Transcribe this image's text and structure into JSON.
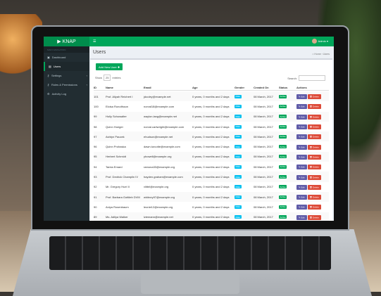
{
  "brand": "KNAP",
  "topbar": {
    "menu_icon": "☰",
    "user": "Admin ▾"
  },
  "sidebar": {
    "heading": "MAIN NAVIGATION",
    "items": [
      {
        "label": "Dashboard",
        "icon": "dashboard-icon",
        "glyph": "▣"
      },
      {
        "label": "Users",
        "icon": "users-icon",
        "glyph": "▤",
        "active": true
      },
      {
        "label": "Settings",
        "icon": "key-icon",
        "glyph": "⚷",
        "chevron": "‹"
      },
      {
        "label": "Roles & Permissions",
        "icon": "key-icon",
        "glyph": "⚷",
        "chevron": "‹"
      },
      {
        "label": "Activity Log",
        "icon": "gear-icon",
        "glyph": "⚙"
      }
    ]
  },
  "page": {
    "title": "Users",
    "breadcrumb": "⌂ Home › Users"
  },
  "toolbar": {
    "add_label": "Add New User ✚",
    "show": "Show",
    "entries_value": "25",
    "entries": "entries",
    "search_label": "Search:",
    "search_value": ""
  },
  "table": {
    "columns": [
      "ID",
      "Name",
      "Email",
      "Age",
      "Gender",
      "Created On",
      "Status",
      "Actions"
    ],
    "edit_label": "✎ Edit",
    "delete_label": "🗑 Delete",
    "rows": [
      [
        "101",
        "Prof. Aliyah Reichert I",
        "jdooley@example.net",
        "0 years, 0 months and 2 days",
        "Male",
        "08 March, 2017",
        "Active"
      ],
      [
        "100",
        "Eloisa Runolfsson",
        "norval18@example.com",
        "0 years, 0 months and 2 days",
        "Male",
        "08 March, 2017",
        "Active"
      ],
      [
        "99",
        "Holly Schowalter",
        "waylon.lang@example.net",
        "0 years, 0 months and 2 days",
        "Male",
        "08 March, 2017",
        "Active"
      ],
      [
        "98",
        "Quinn Hoeger",
        "norval.cartwright@example.com",
        "0 years, 0 months and 2 days",
        "Male",
        "08 March, 2017",
        "Active"
      ],
      [
        "97",
        "Ashtyn Paucek",
        "ehudson@example.net",
        "0 years, 0 months and 2 days",
        "Male",
        "08 March, 2017",
        "Active"
      ],
      [
        "96",
        "Quinn Prohaska",
        "dawn.turcotte@example.com",
        "0 years, 0 months and 2 days",
        "Male",
        "08 March, 2017",
        "Active"
      ],
      [
        "95",
        "Herbert Schmidt",
        "yhowell@example.org",
        "0 years, 0 months and 2 days",
        "Male",
        "08 March, 2017",
        "Active"
      ],
      [
        "94",
        "Tamia Emard",
        "ramona33@example.org",
        "0 years, 0 months and 2 days",
        "Male",
        "08 March, 2017",
        "Active"
      ],
      [
        "93",
        "Prof. Dedrick Champlin IV",
        "hayden.graham@example.com",
        "0 years, 0 months and 2 days",
        "Male",
        "08 March, 2017",
        "Active"
      ],
      [
        "92",
        "Mr. Gregory Huel II",
        "vlittel@example.org",
        "0 years, 0 months and 2 days",
        "Male",
        "08 March, 2017",
        "Active"
      ],
      [
        "91",
        "Prof. Barbara Gottlieb DVM",
        "whitney97@example.org",
        "0 years, 0 months and 2 days",
        "Male",
        "08 March, 2017",
        "Active"
      ],
      [
        "90",
        "Aniya Rosenbaum",
        "leonie12@example.org",
        "0 years, 0 months and 2 days",
        "Male",
        "08 March, 2017",
        "Active"
      ],
      [
        "89",
        "Ms. Adilya Walker",
        "lziemann@example.net",
        "0 years, 0 months and 2 days",
        "Male",
        "08 March, 2017",
        "Active"
      ]
    ]
  },
  "colors": {
    "brand": "#00a65a",
    "sidebar": "#222d32",
    "gender_badge": "#00c0ef",
    "status_badge": "#00a65a",
    "edit": "#605ca8",
    "delete": "#dd4b39"
  }
}
